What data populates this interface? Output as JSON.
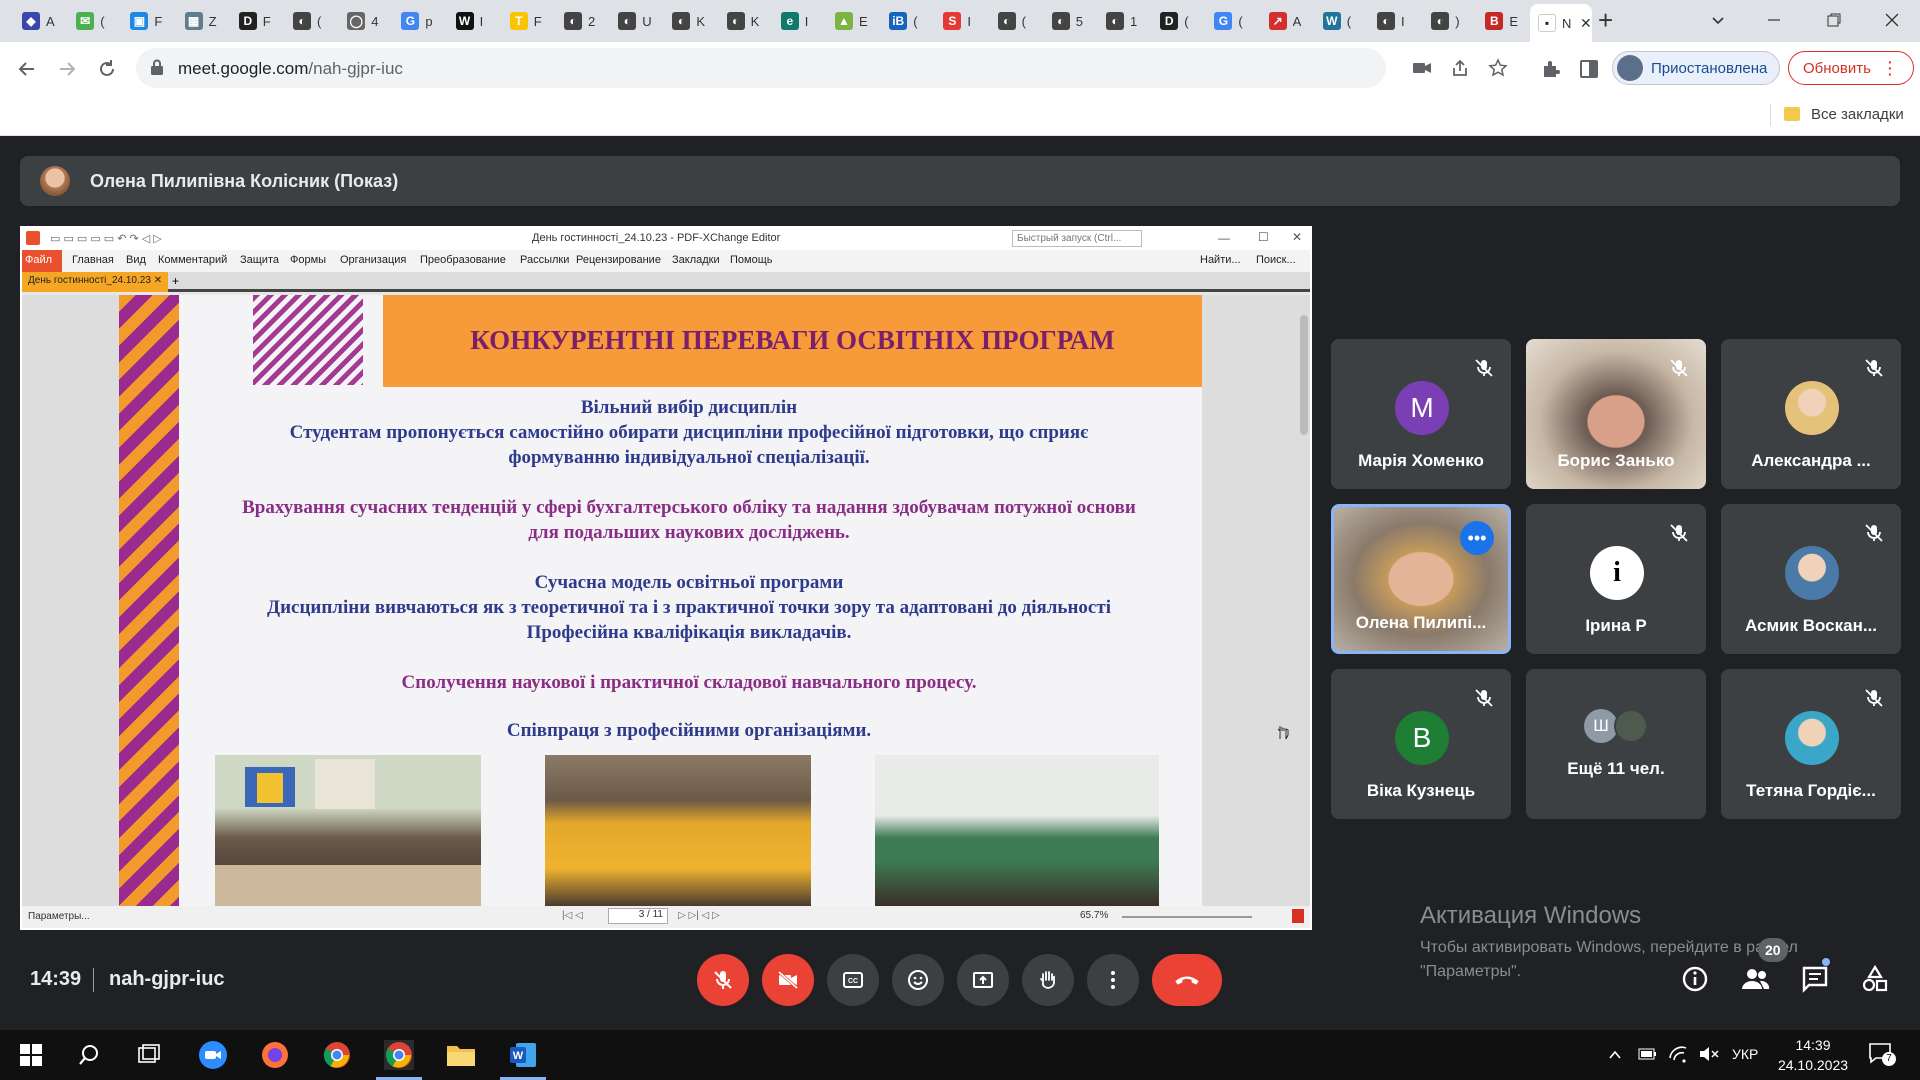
{
  "browser": {
    "tabs": [
      {
        "letter": "◆",
        "color": "#3949ab",
        "short": "A"
      },
      {
        "letter": "✉",
        "color": "#4caf50",
        "short": "("
      },
      {
        "letter": "▣",
        "color": "#1e88e5",
        "short": "F"
      },
      {
        "letter": "▦",
        "color": "#607d8b",
        "short": "Z"
      },
      {
        "letter": "D",
        "color": "#222222",
        "short": "F"
      },
      {
        "letter": "◐",
        "color": "#444444",
        "short": "("
      },
      {
        "letter": "◯",
        "color": "#666666",
        "short": "4"
      },
      {
        "letter": "G",
        "color": "#4285f4",
        "short": "p"
      },
      {
        "letter": "W",
        "color": "#111111",
        "short": "I"
      },
      {
        "letter": "T",
        "color": "#f9c400",
        "short": "F"
      },
      {
        "letter": "◐",
        "color": "#444444",
        "short": "2"
      },
      {
        "letter": "◐",
        "color": "#444444",
        "short": "U"
      },
      {
        "letter": "◐",
        "color": "#444444",
        "short": "K"
      },
      {
        "letter": "◐",
        "color": "#444444",
        "short": "K"
      },
      {
        "letter": "e",
        "color": "#0f7a6a",
        "short": "I"
      },
      {
        "letter": "▲",
        "color": "#7cb342",
        "short": "E"
      },
      {
        "letter": "iB",
        "color": "#1565c0",
        "short": "("
      },
      {
        "letter": "S",
        "color": "#e53935",
        "short": "I"
      },
      {
        "letter": "◐",
        "color": "#444444",
        "short": "("
      },
      {
        "letter": "◐",
        "color": "#444444",
        "short": "5"
      },
      {
        "letter": "◐",
        "color": "#444444",
        "short": "1"
      },
      {
        "letter": "D",
        "color": "#222222",
        "short": "("
      },
      {
        "letter": "G",
        "color": "#4285f4",
        "short": "("
      },
      {
        "letter": "↗",
        "color": "#d32f2f",
        "short": "A"
      },
      {
        "letter": "W",
        "color": "#21759b",
        "short": "("
      },
      {
        "letter": "◐",
        "color": "#444444",
        "short": "I"
      },
      {
        "letter": "◐",
        "color": "#444444",
        "short": ")"
      },
      {
        "letter": "B",
        "color": "#c62828",
        "short": "E"
      }
    ],
    "active_tab": {
      "short": "N",
      "close": "✕"
    },
    "new_tab": "+",
    "url_host": "meet.google.com",
    "url_path": "/nah-gjpr-iuc",
    "profile_label": "Приостановлена",
    "update_label": "Обновить",
    "bookmarks_label": "Все закладки"
  },
  "meet": {
    "presenter": "Олена Пилипівна Колісник (Показ)",
    "time": "14:39",
    "code": "nah-gjpr-iuc",
    "participants_count": "20",
    "tiles": [
      {
        "name": "Марія Хоменко",
        "letter": "M",
        "avatar_color": "#7b3fb5",
        "muted": true
      },
      {
        "name": "Борис Занько",
        "video": true,
        "muted": true
      },
      {
        "name": "Александра ...",
        "avatar_color": "#e5c27a",
        "muted": true
      },
      {
        "name": "Олена Пилипі...",
        "video": true,
        "highlight": true
      },
      {
        "name": "Ірина Р",
        "muted": true
      },
      {
        "name": "Асмик Воскан...",
        "avatar_color": "#4a7aa8",
        "muted": true
      },
      {
        "name": "Віка Кузнець",
        "letter": "B",
        "avatar_color": "#1e7e34",
        "muted": true
      },
      {
        "name": "Ещё 11 чел.",
        "small_letter": "Ш"
      },
      {
        "name": "Тетяна Гордіє...",
        "avatar_color": "#3aa7c9",
        "muted": true
      }
    ]
  },
  "pdf": {
    "window_title": "День гостинності_24.10.23 - PDF-XChange Editor",
    "quick_search": "Быстрый запуск (Ctrl...",
    "menu": [
      "Файл",
      "Главная",
      "Вид",
      "Комментарий",
      "Защита",
      "Формы",
      "Организация",
      "Преобразование",
      "Рассылки",
      "Рецензирование",
      "Закладки",
      "Помощь"
    ],
    "menu_right": [
      "Найти...",
      "Поиск..."
    ],
    "doc_tab": "День гостинності_24.10.23",
    "status_left": "Параметры...",
    "page_field": "3 / 11",
    "zoom": "65.7%"
  },
  "slide": {
    "title": "КОНКУРЕНТНІ ПЕРЕВАГИ ОСВІТНІХ ПРОГРАМ",
    "p1_head": "Вільний вибір дисциплін",
    "p1_body": "Студентам пропонується самостійно обирати дисципліни професійної підготовки, що сприяє формуванню індивідуальної спеціалізації.",
    "p2": "Врахування сучасних тенденцій у сфері бухгалтерського обліку та надання здобувачам потужної основи для подальших наукових досліджень.",
    "p3_head": "Сучасна модель освітньої програми",
    "p3_body": "Дисципліни вивчаються як з теоретичної та і з практичної точки зору та адаптовані до діяльності Професійна кваліфікація викладачів.",
    "p4": "Сполучення наукової і практичної складової навчального процесу.",
    "p5": "Співпраця з професійними організаціями."
  },
  "watermark": {
    "title": "Активация Windows",
    "sub": "Чтобы активировать Windows, перейдите в раздел \"Параметры\"."
  },
  "taskbar": {
    "lang": "УКР",
    "clock_time": "14:39",
    "clock_date": "24.10.2023",
    "notif_count": "7"
  }
}
